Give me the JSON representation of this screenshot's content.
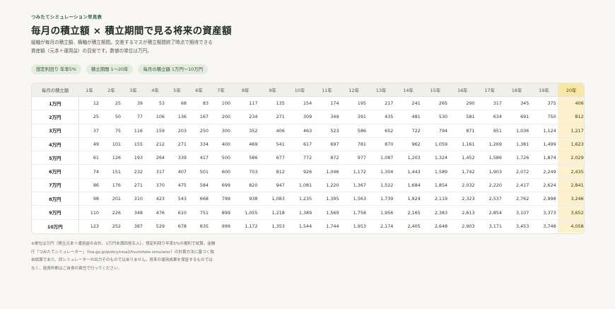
{
  "eyebrow": "つみたてシミュレーション早見表",
  "title": "毎月の積立額 × 積立期間で見る将来の資産額",
  "description": "縦軸が毎月の積立額、横軸が積立期間。交差するマスが積立期間終了時点で期待できる資産額（元本＋運用益）の目安です。数値の単位は万円。",
  "chips": [
    "想定利回り 年率5%",
    "積立期間 1〜20年",
    "毎月の積立額 1万円〜10万円"
  ],
  "table": {
    "corner": "毎月の積立額",
    "columns": [
      "1年",
      "2年",
      "3年",
      "4年",
      "5年",
      "6年",
      "7年",
      "8年",
      "9年",
      "10年",
      "11年",
      "12年",
      "13年",
      "14年",
      "15年",
      "16年",
      "17年",
      "18年",
      "19年",
      "20年"
    ],
    "highlight_column": "20年",
    "highlight_color": "#fbf1cc",
    "rows": [
      {
        "label": "1万円",
        "values": [
          "12",
          "25",
          "39",
          "53",
          "68",
          "83",
          "100",
          "117",
          "135",
          "154",
          "174",
          "195",
          "217",
          "241",
          "265",
          "290",
          "317",
          "345",
          "375",
          "406"
        ]
      },
      {
        "label": "2万円",
        "values": [
          "25",
          "50",
          "77",
          "106",
          "136",
          "167",
          "200",
          "234",
          "271",
          "309",
          "349",
          "391",
          "435",
          "481",
          "530",
          "581",
          "634",
          "691",
          "750",
          "812"
        ]
      },
      {
        "label": "3万円",
        "values": [
          "37",
          "75",
          "116",
          "159",
          "203",
          "250",
          "300",
          "352",
          "406",
          "463",
          "523",
          "586",
          "652",
          "722",
          "794",
          "871",
          "951",
          "1,036",
          "1,124",
          "1,217"
        ]
      },
      {
        "label": "4万円",
        "values": [
          "49",
          "101",
          "155",
          "212",
          "271",
          "334",
          "400",
          "469",
          "541",
          "617",
          "697",
          "781",
          "870",
          "962",
          "1,059",
          "1,161",
          "1,269",
          "1,381",
          "1,499",
          "1,623"
        ]
      },
      {
        "label": "5万円",
        "values": [
          "61",
          "126",
          "193",
          "264",
          "339",
          "417",
          "500",
          "586",
          "677",
          "772",
          "872",
          "977",
          "1,087",
          "1,203",
          "1,324",
          "1,452",
          "1,586",
          "1,726",
          "1,874",
          "2,029"
        ]
      },
      {
        "label": "6万円",
        "values": [
          "74",
          "151",
          "232",
          "317",
          "407",
          "501",
          "600",
          "703",
          "812",
          "926",
          "1,046",
          "1,172",
          "1,304",
          "1,443",
          "1,589",
          "1,742",
          "1,903",
          "2,072",
          "2,249",
          "2,435"
        ]
      },
      {
        "label": "7万円",
        "values": [
          "86",
          "176",
          "271",
          "370",
          "475",
          "584",
          "699",
          "820",
          "947",
          "1,081",
          "1,220",
          "1,367",
          "1,522",
          "1,684",
          "1,854",
          "2,032",
          "2,220",
          "2,417",
          "2,624",
          "2,841"
        ]
      },
      {
        "label": "8万円",
        "values": [
          "98",
          "201",
          "310",
          "423",
          "543",
          "668",
          "799",
          "938",
          "1,083",
          "1,235",
          "1,395",
          "1,563",
          "1,739",
          "1,924",
          "2,119",
          "2,323",
          "2,537",
          "2,762",
          "2,998",
          "3,246"
        ]
      },
      {
        "label": "9万円",
        "values": [
          "110",
          "226",
          "348",
          "476",
          "610",
          "751",
          "899",
          "1,055",
          "1,218",
          "1,389",
          "1,569",
          "1,758",
          "1,956",
          "2,165",
          "2,383",
          "2,613",
          "2,854",
          "3,107",
          "3,373",
          "3,652"
        ]
      },
      {
        "label": "10万円",
        "values": [
          "123",
          "252",
          "387",
          "529",
          "678",
          "835",
          "999",
          "1,172",
          "1,353",
          "1,544",
          "1,744",
          "1,953",
          "2,174",
          "2,405",
          "2,648",
          "2,903",
          "3,171",
          "3,453",
          "3,748",
          "4,058"
        ]
      }
    ]
  },
  "note": "※単位は万円（積立元本＋運用益の合計、1万円未満四捨五入）。想定利回り年率5%の複利で試算。金融庁「つみたてシミュレーター」（fsa.go.jp/policy/nisa2/tsumitate-simulator）の計算方法に基づく独自試算であり、同シミュレーターの出力そのものではありません。将来の運用成果を保証するものではなく、投資判断はご自身の責任で行ってください。"
}
